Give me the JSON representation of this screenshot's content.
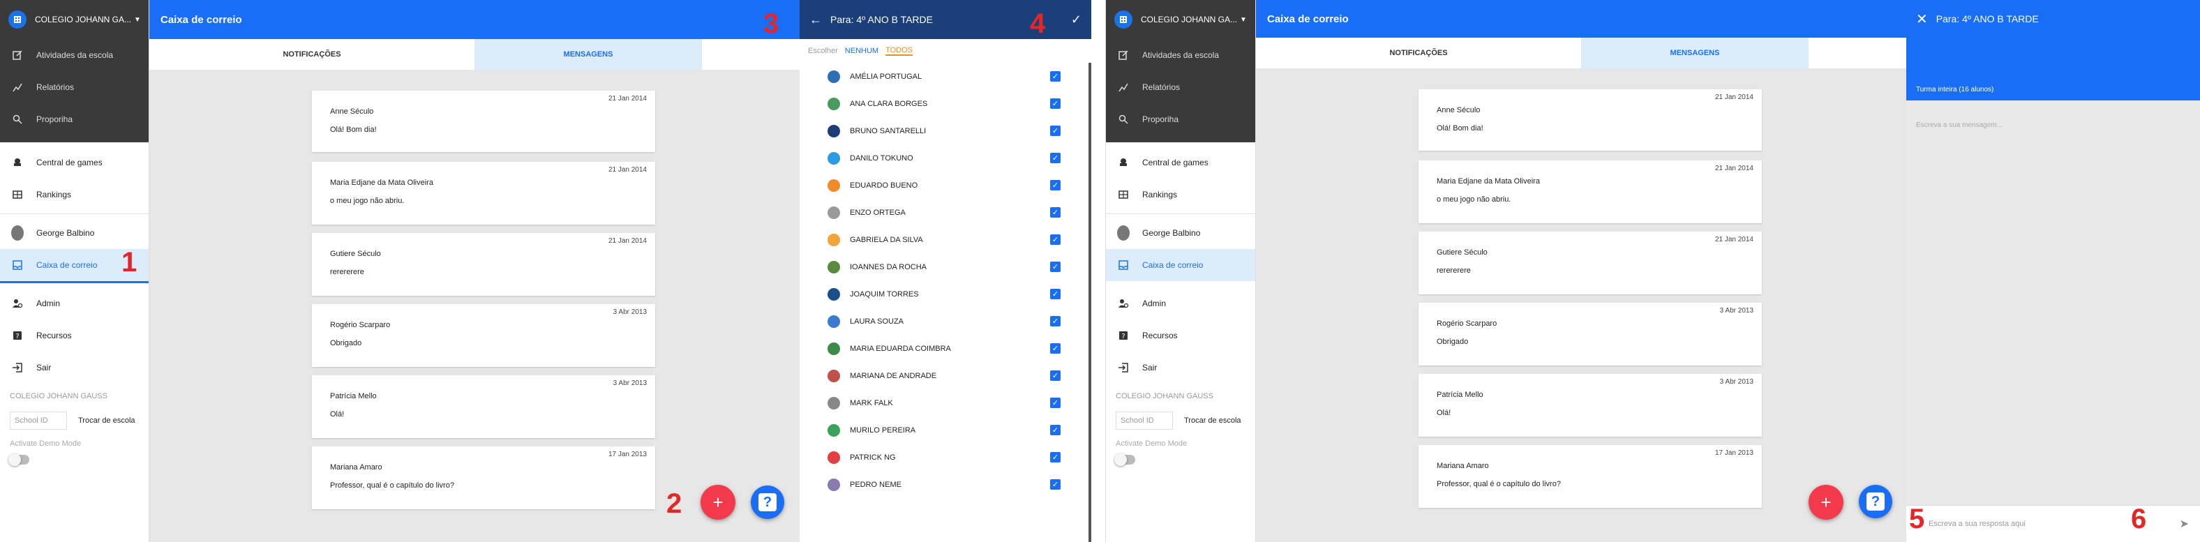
{
  "sidebar": {
    "school_name": "COLEGIO JOHANN GA...",
    "top_items": [
      {
        "label": "Atividades da escola",
        "icon": "edit-icon"
      },
      {
        "label": "Relatórios",
        "icon": "chart-icon"
      },
      {
        "label": "Proporiha",
        "icon": "search-icon"
      }
    ],
    "mid_items": [
      {
        "label": "Central de games",
        "icon": "gamepad-icon"
      },
      {
        "label": "Rankings",
        "icon": "ranking-icon"
      }
    ],
    "user_name": "George Balbino",
    "mailbox_label": "Caixa de correio",
    "bottom_items": [
      {
        "label": "Admin",
        "icon": "admin-icon"
      },
      {
        "label": "Recursos",
        "icon": "help-book-icon"
      },
      {
        "label": "Sair",
        "icon": "exit-icon"
      }
    ],
    "school_footer": "COLEGIO JOHANN GAUSS",
    "school_id_placeholder": "School ID",
    "switch_school": "Trocar de escola",
    "demo_mode": "Activate Demo Mode"
  },
  "mailbox": {
    "title": "Caixa de correio",
    "tabs": [
      "NOTIFICAÇÕES",
      "MENSAGENS"
    ],
    "messages": [
      {
        "date": "21 Jan 2014",
        "name": "Anne Século",
        "text": "Olá! Bom dia!"
      },
      {
        "date": "21 Jan 2014",
        "name": "Maria Edjane da Mata Oliveira",
        "text": "o meu jogo não abriu."
      },
      {
        "date": "21 Jan 2014",
        "name": "Gutiere Século",
        "text": "rerererere"
      },
      {
        "date": "3 Abr 2013",
        "name": "Rogério Scarparo",
        "text": "Obrigado"
      },
      {
        "date": "3 Abr 2013",
        "name": "Patrícia Mello",
        "text": "Olá!"
      },
      {
        "date": "17 Jan 2013",
        "name": "Mariana Amaro",
        "text": "Professor, qual é o capítulo do livro?"
      }
    ],
    "fab_add": "+",
    "fab_help": "?"
  },
  "steps": [
    "1",
    "2",
    "3",
    "4",
    "5",
    "6"
  ],
  "picker": {
    "title": "Para: 4º ANO B TARDE",
    "choose_label": "Escolher",
    "none_label": "NENHUM",
    "all_label": "TODOS",
    "students": [
      {
        "name": "AMÉLIA PORTUGAL",
        "color": "#2d6fb5"
      },
      {
        "name": "ANA CLARA BORGES",
        "color": "#4a9a5e"
      },
      {
        "name": "BRUNO SANTARELLI",
        "color": "#1d3e74"
      },
      {
        "name": "DANILO TOKUNO",
        "color": "#2c9be0"
      },
      {
        "name": "EDUARDO BUENO",
        "color": "#f08a2a"
      },
      {
        "name": "ENZO ORTEGA",
        "color": "#9a9a9a"
      },
      {
        "name": "GABRIELA DA SILVA",
        "color": "#f2a33a"
      },
      {
        "name": "IOANNES DA ROCHA",
        "color": "#5a8a3e"
      },
      {
        "name": "JOAQUIM TORRES",
        "color": "#1b4f8a"
      },
      {
        "name": "LAURA SOUZA",
        "color": "#3a7ad0"
      },
      {
        "name": "MARIA EDUARDA COIMBRA",
        "color": "#3e8a4a"
      },
      {
        "name": "MARIANA DE ANDRADE",
        "color": "#c0504a"
      },
      {
        "name": "MARK FALK",
        "color": "#888888"
      },
      {
        "name": "MURILO PEREIRA",
        "color": "#3aa35a"
      },
      {
        "name": "PATRICK NG",
        "color": "#e04040"
      },
      {
        "name": "PEDRO NEME",
        "color": "#8a7ab0"
      }
    ]
  },
  "compose": {
    "title": "Para: 4º ANO B TARDE",
    "recipients": "Turma inteira (16 alunos)",
    "message_placeholder": "Escreva a sua mensagem...",
    "reply_placeholder": "Escreva a sua resposta aqui"
  },
  "colors": {
    "primary": "#1a6ef5",
    "dark_header": "#1a3f7a",
    "danger": "#f23a4a",
    "sidebar_dark": "#3a3a3a"
  }
}
